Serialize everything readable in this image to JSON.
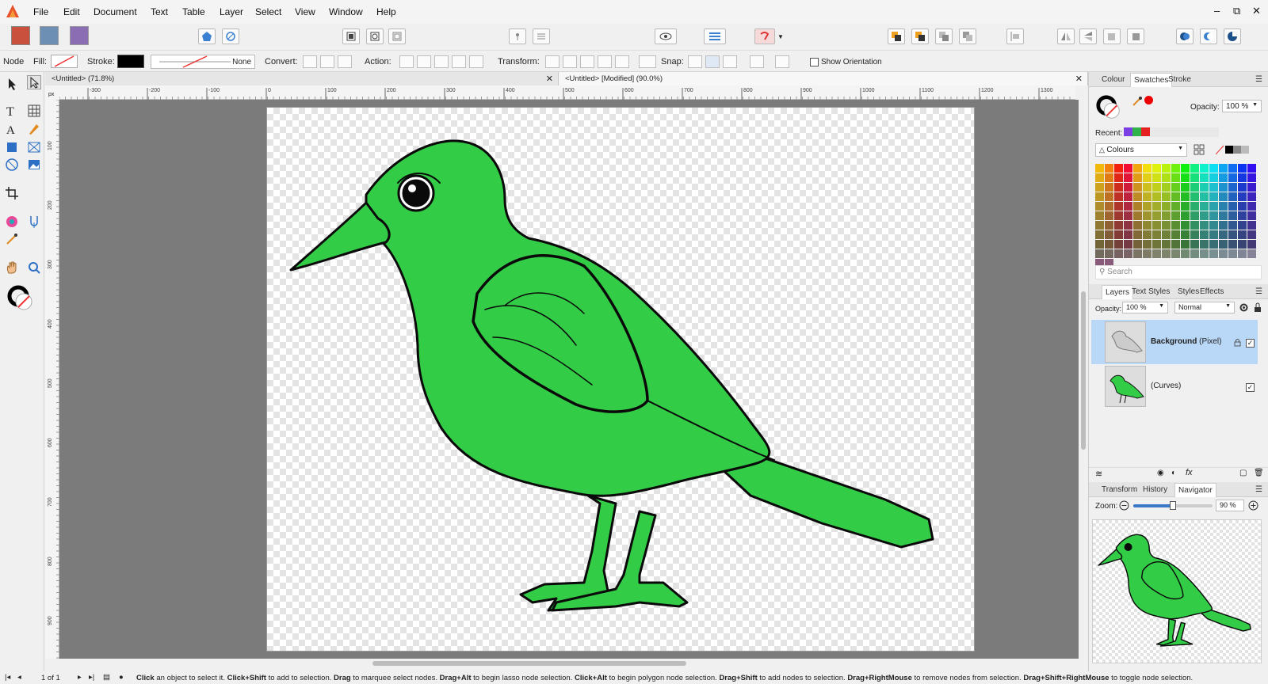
{
  "menu": {
    "items": [
      "File",
      "Edit",
      "Document",
      "Text",
      "Table",
      "Layer",
      "Select",
      "View",
      "Window",
      "Help"
    ],
    "window_controls": [
      "‒",
      "⧉",
      "✕"
    ]
  },
  "context_toolbar": {
    "tool_name": "Node",
    "fill_label": "Fill:",
    "stroke_label": "Stroke:",
    "stroke_width": "None",
    "convert_label": "Convert:",
    "action_label": "Action:",
    "transform_label": "Transform:",
    "snap_label": "Snap:",
    "show_orientation": "Show Orientation"
  },
  "document_tabs": [
    {
      "title": "<Untitled> (71.8%)",
      "close": "✕"
    },
    {
      "title": "<Untitled> [Modified] (90.0%)",
      "close": "✕"
    }
  ],
  "ruler": {
    "h_ticks": [
      "-300",
      "-200",
      "-100",
      "0",
      "100",
      "200",
      "300",
      "400",
      "500",
      "600",
      "700",
      "800",
      "900",
      "1000",
      "1100",
      "1200",
      "1300"
    ],
    "v_ticks": [
      "100",
      "200",
      "300",
      "400",
      "500",
      "600",
      "700",
      "800",
      "900"
    ],
    "unit": "px"
  },
  "colour_panel": {
    "tabs": [
      "Colour",
      "Swatches",
      "Stroke"
    ],
    "active_tab": "Swatches",
    "opacity_label": "Opacity:",
    "opacity_value": "100 %",
    "recent_label": "Recent:",
    "recent_colors": [
      "#7b3fe4",
      "#2fb34a",
      "#e52020"
    ],
    "palette_name": "Colours",
    "search_placeholder": "Search"
  },
  "layers_panel": {
    "tabs": [
      "Layers",
      "Text Styles",
      "Styles",
      "Effects"
    ],
    "active_tab": "Layers",
    "opacity_label": "Opacity:",
    "opacity_value": "100 %",
    "blend_mode": "Normal",
    "layers": [
      {
        "name": "Background",
        "type": "(Pixel)",
        "selected": true,
        "visible": true
      },
      {
        "name": "",
        "type": "(Curves)",
        "selected": false,
        "visible": true
      }
    ]
  },
  "navigator_panel": {
    "tabs": [
      "Transform",
      "History",
      "Navigator"
    ],
    "active_tab": "Navigator",
    "zoom_label": "Zoom:",
    "zoom_value": "90 %",
    "zoom_level": 0.5
  },
  "status_bar": {
    "page": "1 of 1",
    "hint": [
      {
        "b": "Click",
        "t": " an object to select it. "
      },
      {
        "b": "Click+Shift",
        "t": " to add to selection. "
      },
      {
        "b": "Drag",
        "t": " to marquee select nodes. "
      },
      {
        "b": "Drag+Alt",
        "t": " to begin lasso node selection. "
      },
      {
        "b": "Click+Alt",
        "t": " to begin polygon node selection. "
      },
      {
        "b": "Drag+Shift",
        "t": " to add nodes to selection. "
      },
      {
        "b": "Drag+RightMouse",
        "t": " to remove nodes from selection. "
      },
      {
        "b": "Drag+Shift+RightMouse",
        "t": " to toggle node selection."
      }
    ]
  },
  "colors": {
    "bird_fill": "#33cc47",
    "selection": "#b9d8f7",
    "accent": "#3c78c8"
  }
}
